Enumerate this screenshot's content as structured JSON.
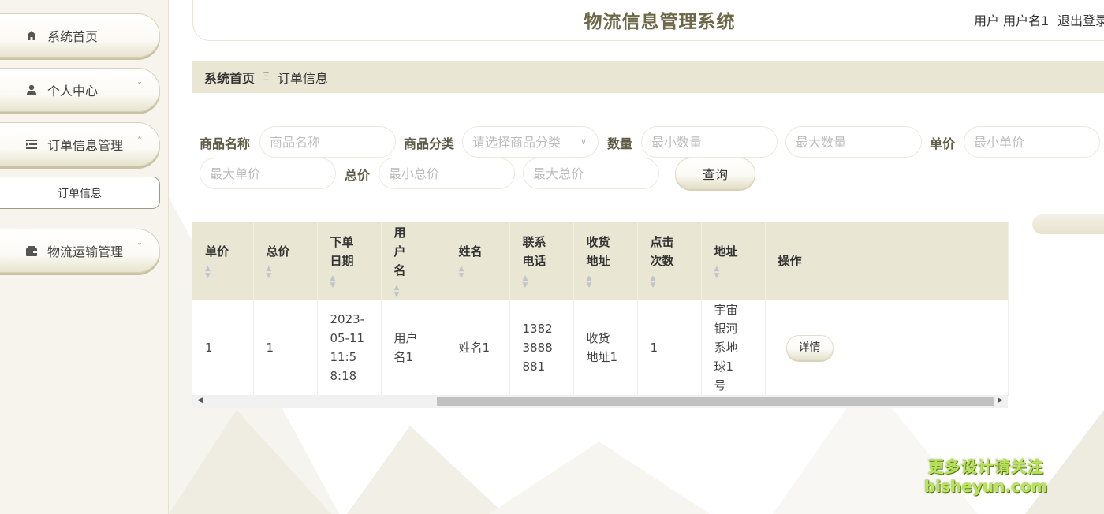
{
  "header": {
    "title": "物流信息管理系统",
    "user": "用户 用户名1",
    "logout": "退出登录"
  },
  "sidebar": {
    "items": [
      {
        "label": "系统首页",
        "icon": "home-icon"
      },
      {
        "label": "个人中心",
        "icon": "user-icon"
      },
      {
        "label": "订单信息管理",
        "icon": "list-icon"
      },
      {
        "label": "物流运输管理",
        "icon": "wallet-icon"
      }
    ],
    "sub_item": "订单信息"
  },
  "breadcrumb": {
    "home": "系统首页",
    "separator": "Ξ",
    "current": "订单信息"
  },
  "search": {
    "product_name_label": "商品名称",
    "product_name_placeholder": "商品名称",
    "category_label": "商品分类",
    "category_placeholder": "请选择商品分类",
    "quantity_label": "数量",
    "min_quantity_placeholder": "最小数量",
    "max_quantity_placeholder": "最大数量",
    "unit_price_label": "单价",
    "min_unit_price_placeholder": "最小单价",
    "max_unit_price_placeholder": "最大单价",
    "total_label": "总价",
    "min_total_placeholder": "最小总价",
    "max_total_placeholder": "最大总价",
    "query_button": "查询"
  },
  "table": {
    "columns": [
      "单价",
      "总价",
      "下单日期",
      "用户名",
      "姓名",
      "联系电话",
      "收货地址",
      "点击次数",
      "地址",
      "操作"
    ],
    "rows": [
      {
        "unit_price": "1",
        "total": "1",
        "order_date": "2023-05-11 11:58:18",
        "username": "用户名1",
        "name": "姓名1",
        "phone": "13823888881",
        "delivery_address": "收货地址1",
        "clicks": "1",
        "address": "宇宙银河系地球1号",
        "action": "详情"
      }
    ]
  },
  "watermark": {
    "line1": "更多设计请关注",
    "line2": "bisheyun.com"
  },
  "colors": {
    "accent": "#e9e6d3",
    "title": "#6e6848",
    "watermark": "#b8e45a"
  }
}
